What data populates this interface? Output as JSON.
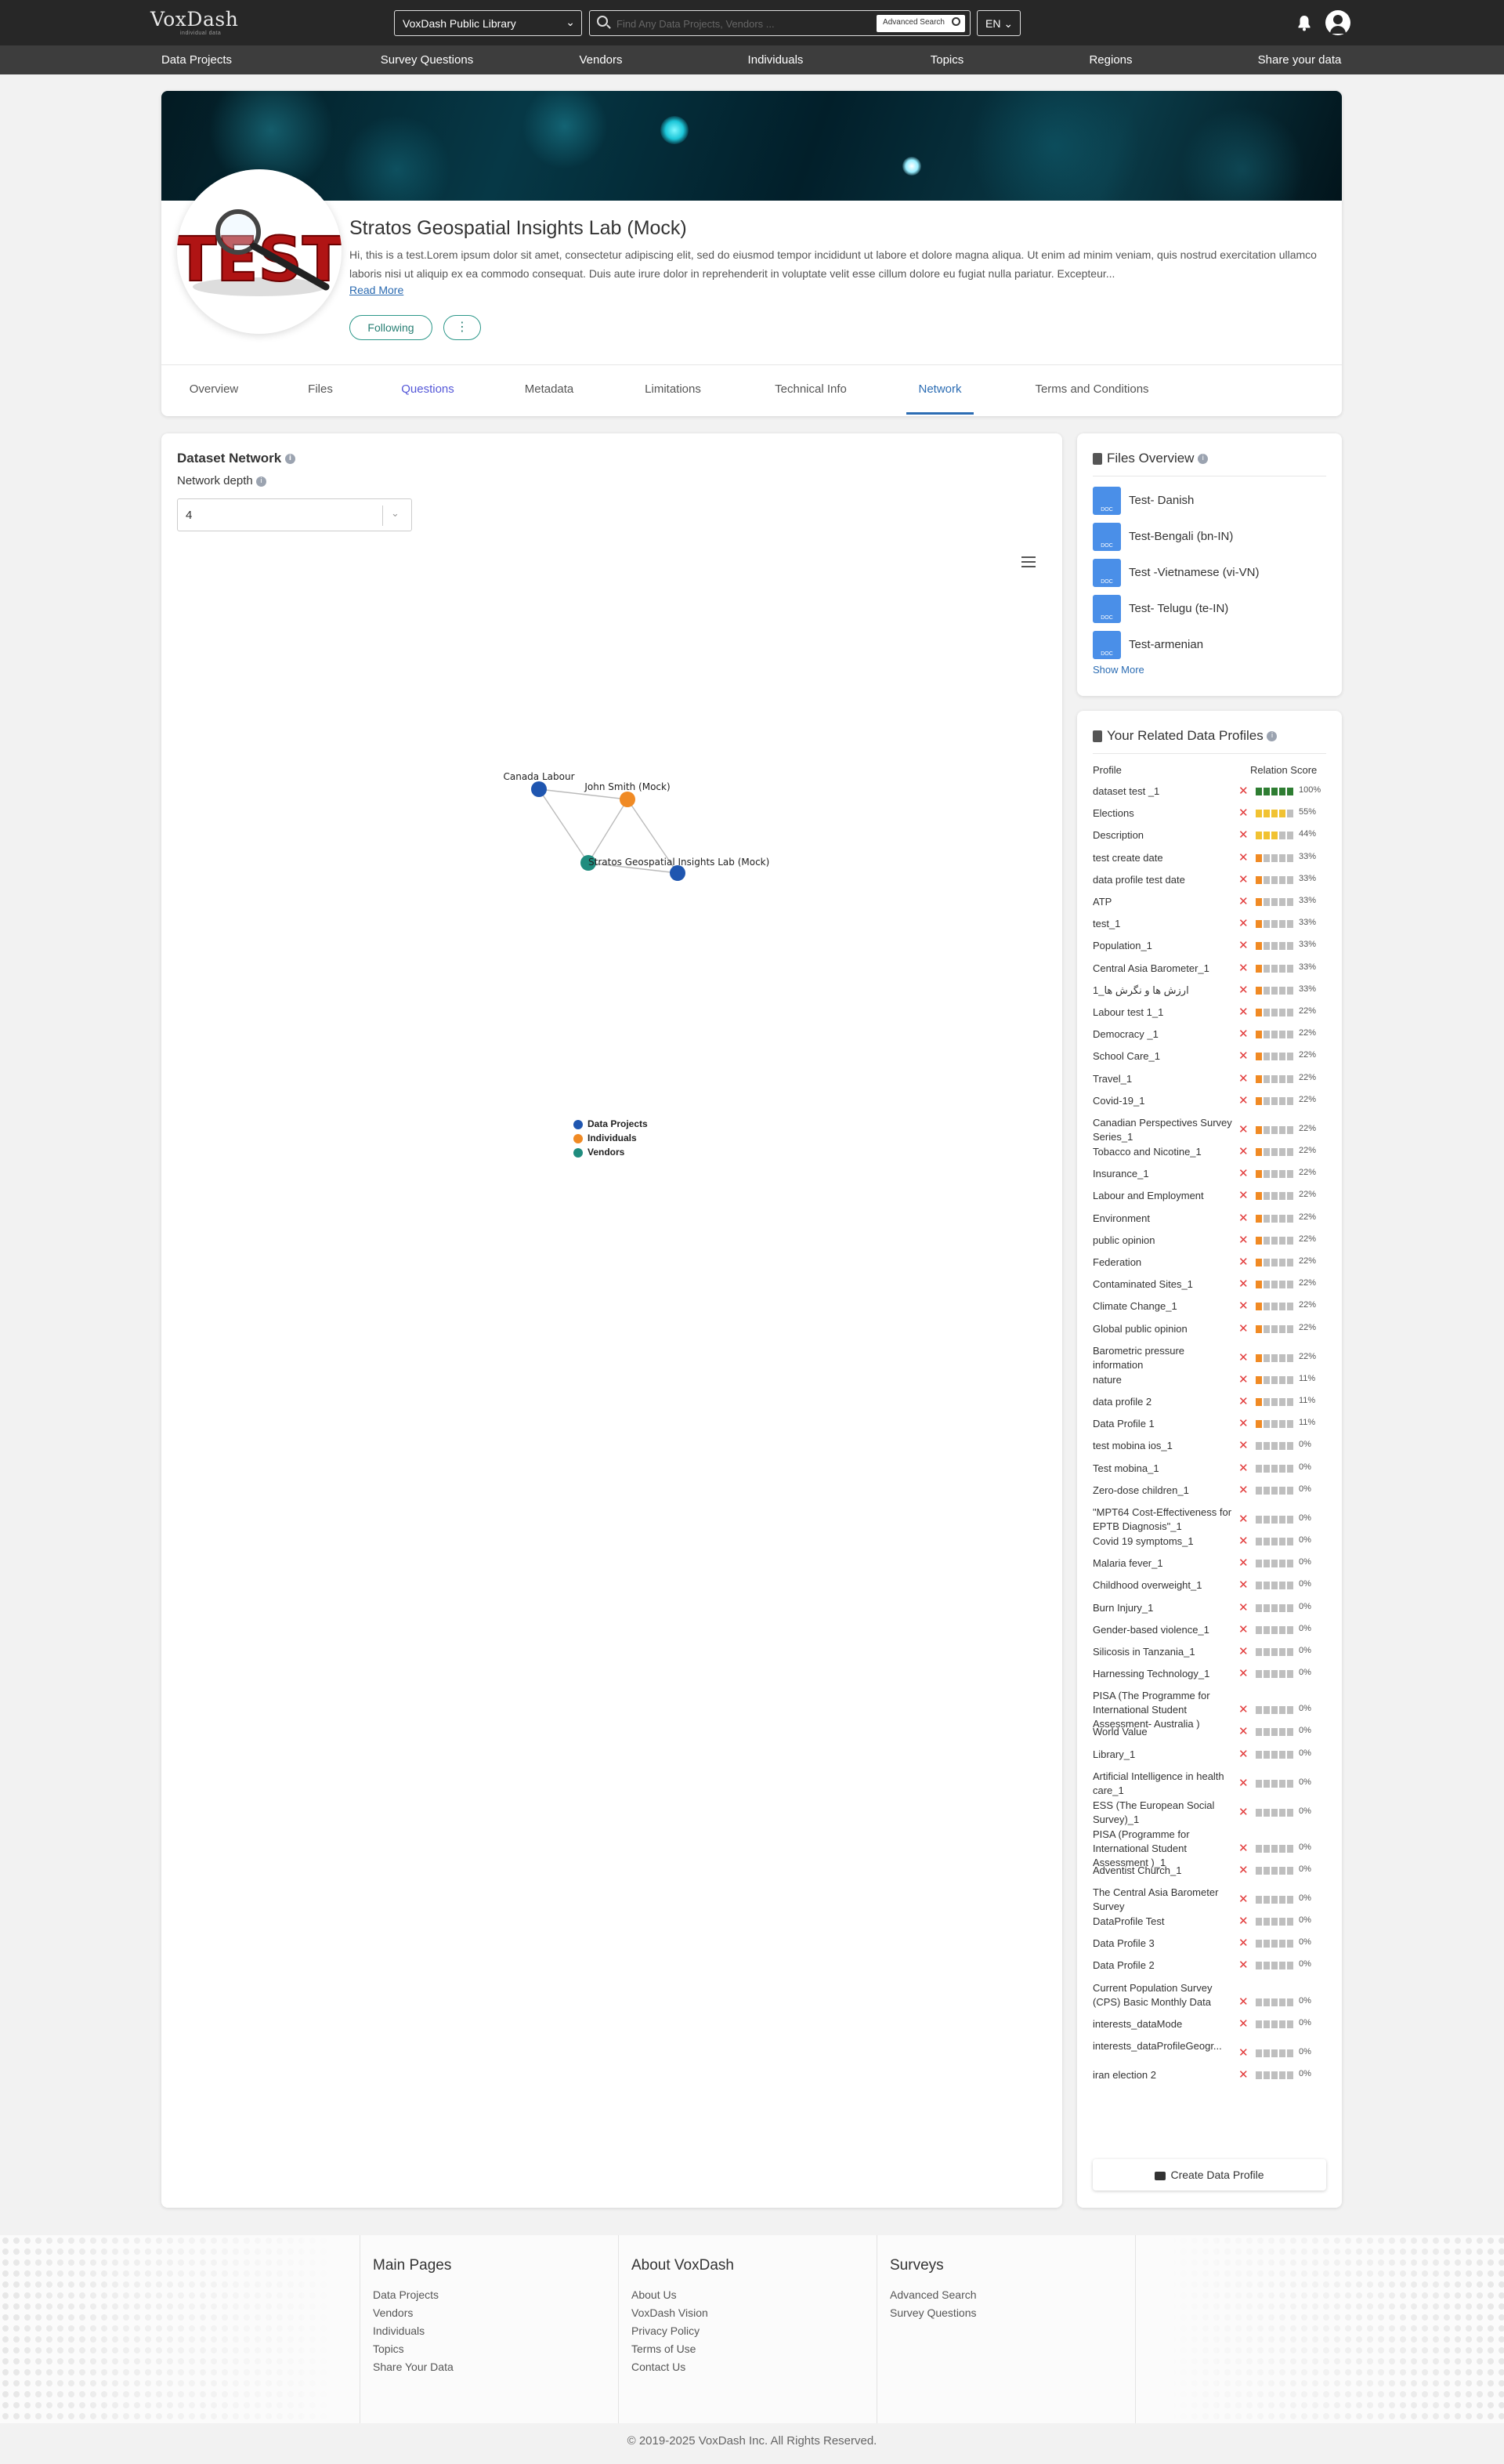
{
  "header": {
    "logo": "VoxDash",
    "logo_tagline": "individual data",
    "library": "VoxDash Public Library",
    "search_placeholder": "Find Any Data Projects, Vendors ...",
    "advanced_search": "Advanced Search",
    "lang": "EN"
  },
  "nav": [
    "Data Projects",
    "Survey Questions",
    "Vendors",
    "Individuals",
    "Topics",
    "Regions",
    "Share your data"
  ],
  "profile": {
    "title": "Stratos Geospatial Insights Lab (Mock)",
    "logo_text": "TEST",
    "description": "Hi, this is a test.Lorem ipsum dolor sit amet, consectetur adipiscing elit, sed do eiusmod tempor incididunt ut labore et dolore magna aliqua. Ut enim ad minim veniam, quis nostrud exercitation ullamco laboris nisi ut aliquip ex ea commodo consequat. Duis aute irure dolor in reprehenderit in voluptate velit esse cillum dolore eu fugiat nulla pariatur. Excepteur...",
    "read_more": "Read More",
    "following": "Following"
  },
  "tabs": [
    "Overview",
    "Files",
    "Questions",
    "Metadata",
    "Limitations",
    "Technical Info",
    "Network",
    "Terms and Conditions"
  ],
  "network": {
    "title": "Dataset Network",
    "depth_label": "Network depth",
    "depth_value": "4",
    "nodes": [
      {
        "label": "Canada Labour",
        "type": "project"
      },
      {
        "label": "John Smith (Mock)",
        "type": "individual"
      },
      {
        "label": "Stratos Geospatial Insights Lab (Mock)",
        "type": "vendor"
      },
      {
        "label": "",
        "type": "project"
      }
    ],
    "legend": [
      {
        "label": "Data Projects",
        "color": "#1f56b0"
      },
      {
        "label": "Individuals",
        "color": "#f08a24"
      },
      {
        "label": "Vendors",
        "color": "#1f8c7e"
      }
    ]
  },
  "files": {
    "title": "Files Overview",
    "items": [
      "Test- Danish",
      "Test-Bengali (bn-IN)",
      "Test -Vietnamese (vi-VN)",
      "Test- Telugu (te-IN)",
      "Test-armenian"
    ],
    "show_more": "Show More",
    "icon_letter": "W",
    "icon_sub": "DOC"
  },
  "related": {
    "title": "Your Related Data Profiles",
    "col_profile": "Profile",
    "col_score": "Relation Score",
    "create": "Create Data Profile",
    "rows": [
      {
        "name": "dataset test _1",
        "pct": "100%",
        "score": 100
      },
      {
        "name": "Elections",
        "pct": "55%",
        "score": 55
      },
      {
        "name": "Description",
        "pct": "44%",
        "score": 44
      },
      {
        "name": "test create date",
        "pct": "33%",
        "score": 33
      },
      {
        "name": "data profile test date",
        "pct": "33%",
        "score": 33
      },
      {
        "name": "ATP",
        "pct": "33%",
        "score": 33
      },
      {
        "name": "test_1",
        "pct": "33%",
        "score": 33
      },
      {
        "name": "Population_1",
        "pct": "33%",
        "score": 33
      },
      {
        "name": "Central Asia Barometer_1",
        "pct": "33%",
        "score": 33
      },
      {
        "name": "ارزش ها و نگرش ها_1",
        "pct": "33%",
        "score": 33
      },
      {
        "name": "Labour test 1_1",
        "pct": "22%",
        "score": 22
      },
      {
        "name": "Democracy _1",
        "pct": "22%",
        "score": 22
      },
      {
        "name": "School Care_1",
        "pct": "22%",
        "score": 22
      },
      {
        "name": "Travel_1",
        "pct": "22%",
        "score": 22
      },
      {
        "name": "Covid-19_1",
        "pct": "22%",
        "score": 22
      },
      {
        "name": "Canadian Perspectives Survey Series_1",
        "pct": "22%",
        "score": 22
      },
      {
        "name": "Tobacco and Nicotine_1",
        "pct": "22%",
        "score": 22
      },
      {
        "name": "Insurance_1",
        "pct": "22%",
        "score": 22
      },
      {
        "name": "Labour and Employment",
        "pct": "22%",
        "score": 22
      },
      {
        "name": "Environment",
        "pct": "22%",
        "score": 22
      },
      {
        "name": "public opinion",
        "pct": "22%",
        "score": 22
      },
      {
        "name": "Federation",
        "pct": "22%",
        "score": 22
      },
      {
        "name": "Contaminated Sites_1",
        "pct": "22%",
        "score": 22
      },
      {
        "name": "Climate Change_1",
        "pct": "22%",
        "score": 22
      },
      {
        "name": "Global public opinion",
        "pct": "22%",
        "score": 22
      },
      {
        "name": "Barometric pressure information",
        "pct": "22%",
        "score": 22
      },
      {
        "name": "nature",
        "pct": "11%",
        "score": 11
      },
      {
        "name": "data profile 2",
        "pct": "11%",
        "score": 11
      },
      {
        "name": "Data Profile 1",
        "pct": "11%",
        "score": 11
      },
      {
        "name": "test mobina ios_1",
        "pct": "0%",
        "score": 0
      },
      {
        "name": "Test mobina_1",
        "pct": "0%",
        "score": 0
      },
      {
        "name": "Zero-dose children_1",
        "pct": "0%",
        "score": 0
      },
      {
        "name": "\"MPT64 Cost-Effectiveness for EPTB Diagnosis\"_1",
        "pct": "0%",
        "score": 0
      },
      {
        "name": "Covid 19 symptoms_1",
        "pct": "0%",
        "score": 0
      },
      {
        "name": "Malaria fever_1",
        "pct": "0%",
        "score": 0
      },
      {
        "name": "Childhood overweight_1",
        "pct": "0%",
        "score": 0
      },
      {
        "name": "Burn Injury_1",
        "pct": "0%",
        "score": 0
      },
      {
        "name": "Gender-based violence_1",
        "pct": "0%",
        "score": 0
      },
      {
        "name": "Silicosis in Tanzania_1",
        "pct": "0%",
        "score": 0
      },
      {
        "name": "Harnessing Technology_1",
        "pct": "0%",
        "score": 0
      },
      {
        "name": "PISA (The Programme for International Student Assessment- Australia )",
        "pct": "0%",
        "score": 0
      },
      {
        "name": "World Value",
        "pct": "0%",
        "score": 0
      },
      {
        "name": "Library_1",
        "pct": "0%",
        "score": 0
      },
      {
        "name": "Artificial Intelligence in health care_1",
        "pct": "0%",
        "score": 0
      },
      {
        "name": "ESS (The European Social Survey)_1",
        "pct": "0%",
        "score": 0
      },
      {
        "name": "PISA (Programme for International Student Assessment )_1",
        "pct": "0%",
        "score": 0
      },
      {
        "name": "Adventist Church_1",
        "pct": "0%",
        "score": 0
      },
      {
        "name": "The Central Asia Barometer Survey",
        "pct": "0%",
        "score": 0
      },
      {
        "name": "DataProfile Test",
        "pct": "0%",
        "score": 0
      },
      {
        "name": "Data Profile 3",
        "pct": "0%",
        "score": 0
      },
      {
        "name": "Data Profile 2",
        "pct": "0%",
        "score": 0
      },
      {
        "name": "Current Population Survey (CPS) Basic Monthly Data",
        "pct": "0%",
        "score": 0
      },
      {
        "name": "interests_dataMode",
        "pct": "0%",
        "score": 0
      },
      {
        "name": "interests_dataProfileGeogr...",
        "pct": "0%",
        "score": 0
      },
      {
        "name": "iran election 2",
        "pct": "0%",
        "score": 0
      }
    ]
  },
  "footer": {
    "columns": [
      {
        "title": "Main Pages",
        "links": [
          "Data Projects",
          "Vendors",
          "Individuals",
          "Topics",
          "Share Your Data"
        ]
      },
      {
        "title": "About VoxDash",
        "links": [
          "About Us",
          "VoxDash Vision",
          "Privacy Policy",
          "Terms of Use",
          "Contact Us"
        ]
      },
      {
        "title": "Surveys",
        "links": [
          "Advanced Search",
          "Survey Questions"
        ]
      }
    ],
    "copyright": "© 2019-2025 VoxDash Inc. All Rights Reserved."
  },
  "colors": {
    "accent": "#2b6cb3",
    "teal": "#2b9789",
    "score_green": "#2e7d32",
    "score_yellow": "#f1c232",
    "score_orange": "#f08a24",
    "score_gray": "#bfbfbf"
  }
}
